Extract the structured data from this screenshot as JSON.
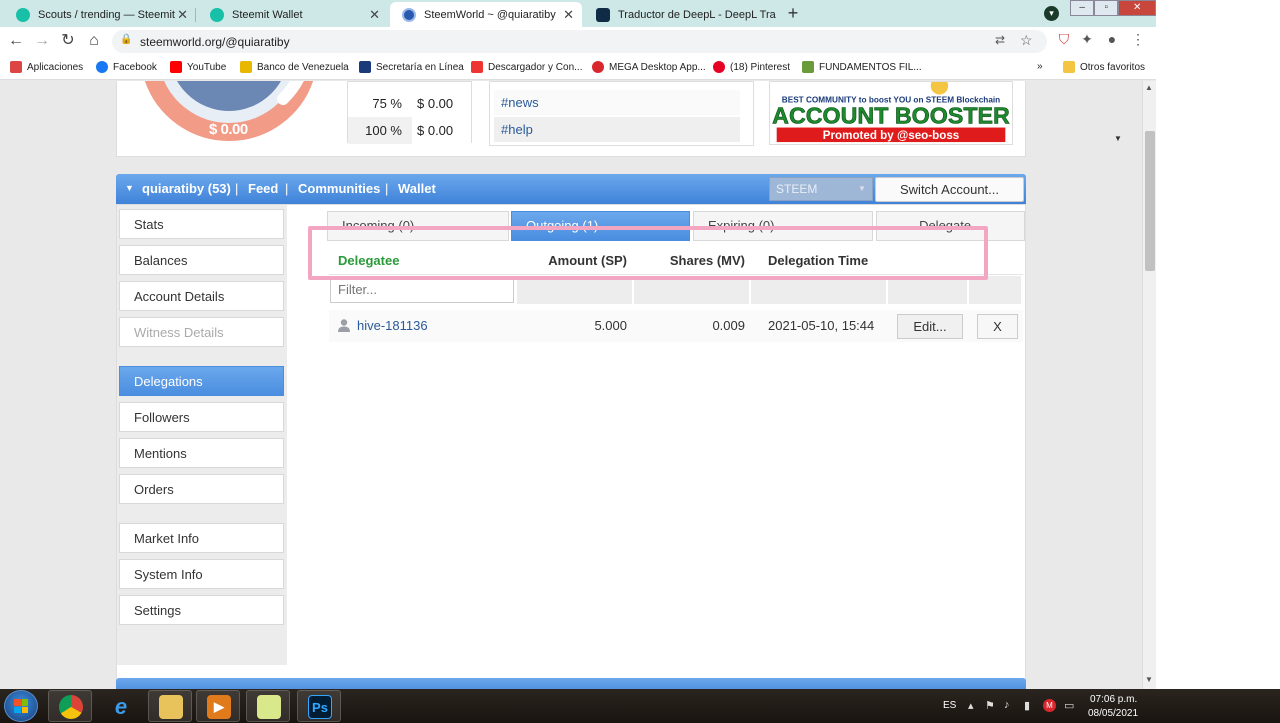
{
  "browser": {
    "tabs": [
      {
        "title": "Scouts / trending — Steemit",
        "color": "#18c0a8"
      },
      {
        "title": "Steemit Wallet",
        "color": "#18c0a8"
      },
      {
        "title": "SteemWorld ~ @quiaratiby",
        "color": "#2a5ab0"
      },
      {
        "title": "Traductor de DeepL - DeepL Tra",
        "color": "#0f2b46"
      }
    ],
    "new_tab": "+",
    "window_controls": {
      "minimize": "–",
      "maximize": "▫",
      "close": "✕"
    },
    "url": "steemworld.org/@quiaratiby",
    "bookmarks": [
      {
        "label": "Aplicaciones",
        "color": "#d44"
      },
      {
        "label": "Facebook",
        "color": "#1877f2"
      },
      {
        "label": "YouTube",
        "color": "#ff0000"
      },
      {
        "label": "Banco de Venezuela",
        "color": "#e8b800"
      },
      {
        "label": "Secretaría en Línea",
        "color": "#1a3a7a"
      },
      {
        "label": "Descargador y Con...",
        "color": "#e33"
      },
      {
        "label": "MEGA Desktop App...",
        "color": "#d9272e"
      },
      {
        "label": "(18) Pinterest",
        "color": "#e60023"
      },
      {
        "label": "FUNDAMENTOS FIL...",
        "color": "#6a9a3a"
      }
    ],
    "bookmarks_more": "»",
    "other_bookmarks": "Otros favoritos"
  },
  "top": {
    "gauge_value": "$ 0.00",
    "vote_rows": [
      {
        "pct": "75 %",
        "value": "$ 0.00"
      },
      {
        "pct": "100 %",
        "value": "$ 0.00"
      }
    ],
    "tags": [
      "#news",
      "#help"
    ],
    "banner": {
      "line1": "BEST COMMUNITY to boost YOU on STEEM Blockchain",
      "line2": "ACCOUNT BOOSTER",
      "line3": "Promoted by @seo-boss"
    }
  },
  "account_bar": {
    "caret": "▼",
    "user": "quiaratiby (53)",
    "sep": "|",
    "links": [
      "Feed",
      "Communities",
      "Wallet"
    ],
    "coin": "STEEM",
    "switch_label": "Switch Account..."
  },
  "sidebar": {
    "items": [
      {
        "label": "Stats",
        "state": "normal"
      },
      {
        "label": "Balances",
        "state": "normal"
      },
      {
        "label": "Account Details",
        "state": "normal"
      },
      {
        "label": "Witness Details",
        "state": "disabled"
      },
      {
        "label": "Delegations",
        "state": "active"
      },
      {
        "label": "Followers",
        "state": "normal"
      },
      {
        "label": "Mentions",
        "state": "normal"
      },
      {
        "label": "Orders",
        "state": "normal"
      },
      {
        "label": "Market Info",
        "state": "normal"
      },
      {
        "label": "System Info",
        "state": "normal"
      },
      {
        "label": "Settings",
        "state": "normal"
      }
    ]
  },
  "delegations": {
    "subtabs": [
      "Incoming (0)",
      "Outgoing (1)",
      "Expiring (0)",
      "Delegate..."
    ],
    "active_subtab": 1,
    "columns": [
      "Delegatee",
      "Amount (SP)",
      "Shares (MV)",
      "Delegation Time"
    ],
    "filter_placeholder": "Filter...",
    "rows": [
      {
        "delegatee": "hive-181136",
        "amount": "5.000",
        "shares": "0.009",
        "time": "2021-05-10, 15:44"
      }
    ],
    "edit_label": "Edit...",
    "remove_label": "X"
  },
  "taskbar": {
    "lang": "ES",
    "time": "07:06 p.m.",
    "date": "08/05/2021"
  },
  "colors": {
    "accent_blue": "#4a8ee0",
    "link_blue": "#2a5a9a",
    "delegatee_green": "#2a9a3a",
    "highlight_pink": "#f2a6c2"
  }
}
